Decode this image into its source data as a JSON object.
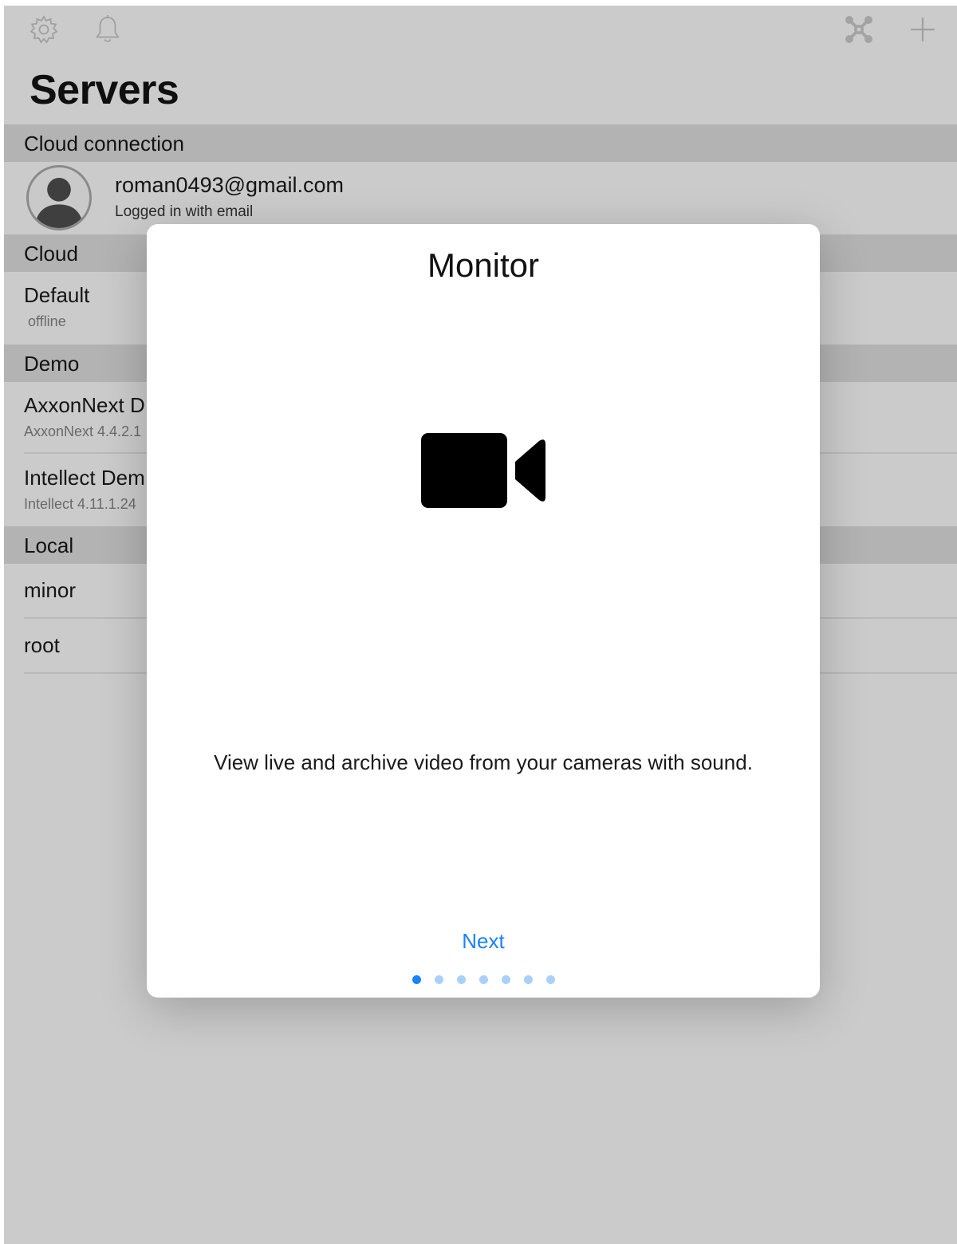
{
  "header": {
    "title": "Servers",
    "icons": [
      "gear-icon",
      "bell-icon",
      "network-icon",
      "plus-icon"
    ]
  },
  "cloud_connection": {
    "header": "Cloud connection",
    "email": "roman0493@gmail.com",
    "status": "Logged in with email"
  },
  "sections": [
    {
      "header": "Cloud",
      "items": [
        {
          "title": "Default",
          "subtitle": "offline"
        }
      ]
    },
    {
      "header": "Demo",
      "items": [
        {
          "title": "AxxonNext D",
          "subtitle": "AxxonNext 4.4.2.1"
        },
        {
          "title": "Intellect Dem",
          "subtitle": "Intellect 4.11.1.24"
        }
      ]
    },
    {
      "header": "Local",
      "items": [
        {
          "title": "minor"
        },
        {
          "title": "root"
        }
      ]
    }
  ],
  "modal": {
    "title": "Monitor",
    "icon": "video-camera-icon",
    "description": "View live and archive video from your cameras with sound.",
    "next_label": "Next",
    "page_count": 7,
    "current_page": 1
  },
  "colors": {
    "accent": "#1a82fb",
    "overlay_background": "#cbcbcb",
    "section_header": "#b3b3b3"
  }
}
